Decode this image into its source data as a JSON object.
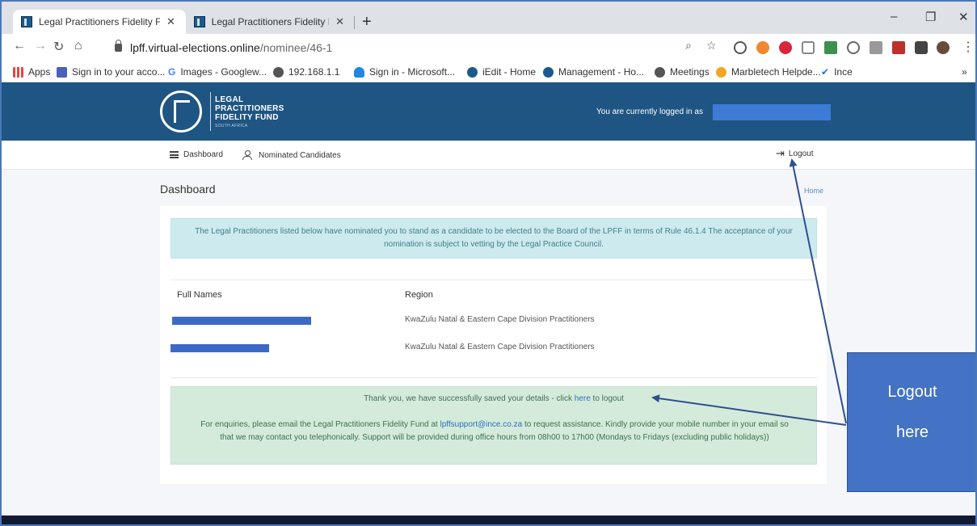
{
  "browser": {
    "tabs": [
      {
        "title": "Legal Practitioners Fidelity Fund |"
      },
      {
        "title": "Legal Practitioners Fidelity Fund |"
      }
    ],
    "new_tab": "+",
    "close": "✕",
    "window_controls": {
      "minimize": "–",
      "restore": "❐",
      "close": "✕"
    },
    "url_host": "lpff.virtual-elections.online",
    "url_path": "/nominee/46-1",
    "bookmarks": [
      {
        "label": "Apps",
        "color": "#e8453c"
      },
      {
        "label": "Sign in to your acco...",
        "color": "#4b5fbd"
      },
      {
        "label": "Images - Googlew...",
        "color": "#4285f4"
      },
      {
        "label": "192.168.1.1",
        "color": "#555555"
      },
      {
        "label": "Sign in - Microsoft...",
        "color": "#1e88e5"
      },
      {
        "label": "iEdit - Home",
        "color": "#1b5a8c"
      },
      {
        "label": "Management - Ho...",
        "color": "#1b5a8c"
      },
      {
        "label": "Meetings",
        "color": "#555555"
      },
      {
        "label": "Marbletech Helpde...",
        "color": "#f4a523"
      },
      {
        "label": "Ince",
        "color": "#1a73e8"
      }
    ],
    "bookmarks_more": "»"
  },
  "header": {
    "logo_lines": [
      "LEGAL",
      "PRACTITIONERS",
      "FIDELITY FUND"
    ],
    "logo_sub": "SOUTH AFRICA",
    "logged_in_text": "You are currently logged in as"
  },
  "menu": {
    "dashboard": "Dashboard",
    "nominated": "Nominated Candidates",
    "logout": "Logout"
  },
  "page": {
    "title": "Dashboard",
    "breadcrumb": "Home",
    "info_text": "The Legal Practitioners listed below have nominated you to stand as a candidate to be elected to the Board of the LPFF in terms of Rule 46.1.4 The acceptance of your nomination is subject to vetting by the Legal Practice Council.",
    "table": {
      "headers": [
        "Full Names",
        "Region"
      ],
      "rows": [
        {
          "region": "KwaZulu Natal & Eastern Cape Division Practitioners"
        },
        {
          "region": "KwaZulu Natal & Eastern Cape Division Practitioners"
        }
      ]
    },
    "success_pre": "Thank you, we have successfully saved your details - click ",
    "success_link": "here",
    "success_post": " to logout",
    "enquiry_pre": "For enquiries, please email the Legal Practitioners Fidelity Fund at ",
    "enquiry_email": "lpffsupport@ince.co.za",
    "enquiry_post": " to request assistance. Kindly provide your mobile number in your email so that we may contact you telephonically. Support will be provided during office hours from 08h00 to 17h00 (Mondays to Fridays (excluding public holidays))"
  },
  "annotation": {
    "line1": "Logout",
    "line2": "here"
  }
}
